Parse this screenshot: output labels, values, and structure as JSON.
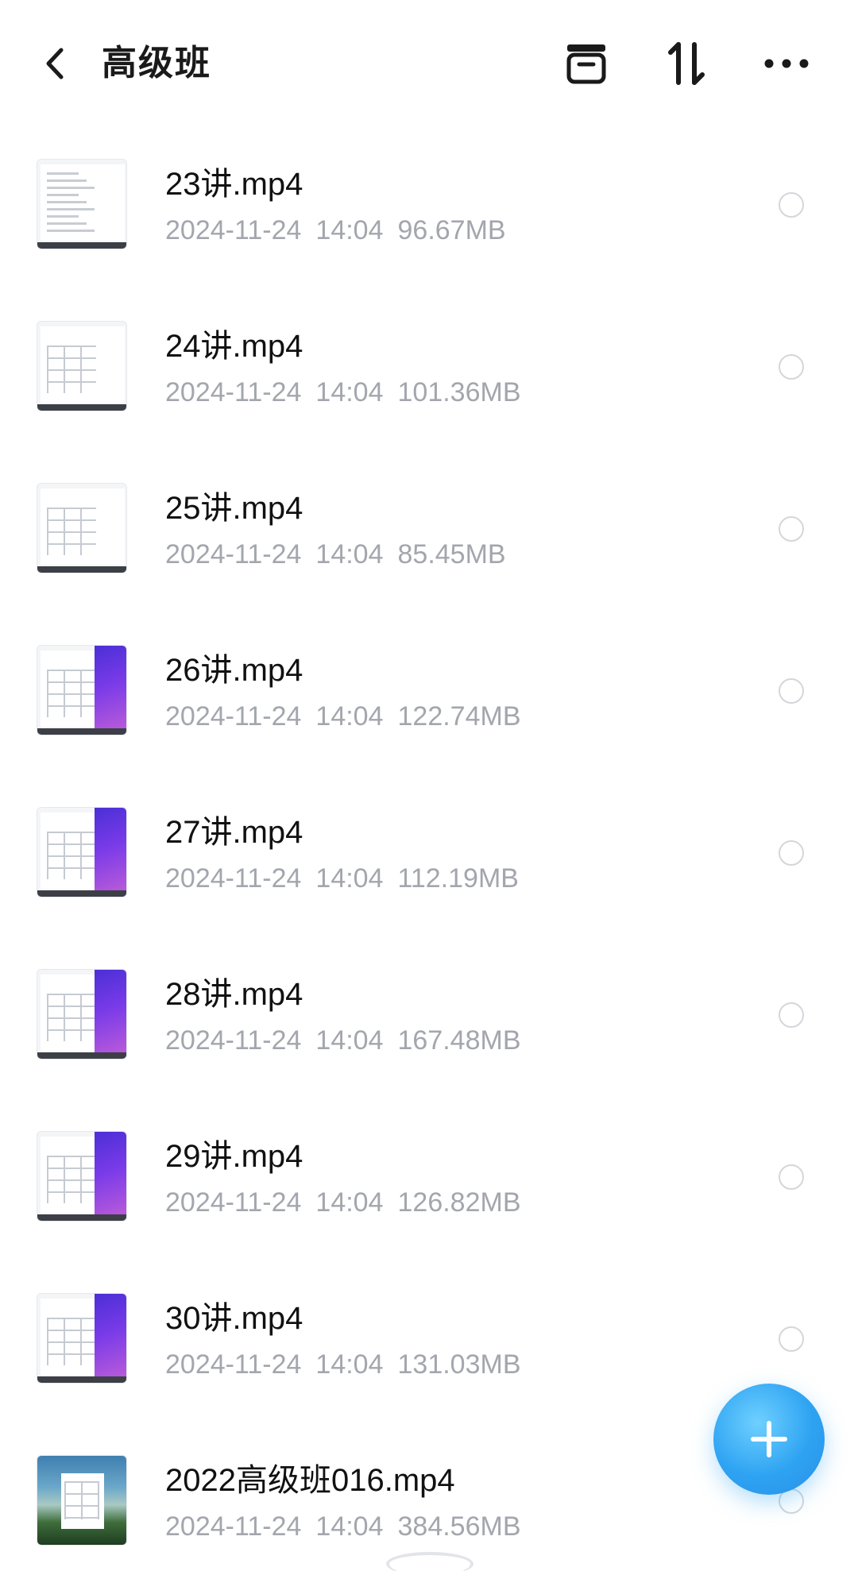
{
  "header": {
    "title": "高级班",
    "back_icon": "chevron-left-icon",
    "actions": [
      "archive-box-icon",
      "sort-arrows-icon",
      "more-horizontal-icon"
    ]
  },
  "files": [
    {
      "name": "23讲.mp4",
      "date": "2024-11-24",
      "time": "14:04",
      "size": "96.67MB",
      "thumb": "doc"
    },
    {
      "name": "24讲.mp4",
      "date": "2024-11-24",
      "time": "14:04",
      "size": "101.36MB",
      "thumb": "doc-grid"
    },
    {
      "name": "25讲.mp4",
      "date": "2024-11-24",
      "time": "14:04",
      "size": "85.45MB",
      "thumb": "doc-grid"
    },
    {
      "name": "26讲.mp4",
      "date": "2024-11-24",
      "time": "14:04",
      "size": "122.74MB",
      "thumb": "purple"
    },
    {
      "name": "27讲.mp4",
      "date": "2024-11-24",
      "time": "14:04",
      "size": "112.19MB",
      "thumb": "purple"
    },
    {
      "name": "28讲.mp4",
      "date": "2024-11-24",
      "time": "14:04",
      "size": "167.48MB",
      "thumb": "purple"
    },
    {
      "name": "29讲.mp4",
      "date": "2024-11-24",
      "time": "14:04",
      "size": "126.82MB",
      "thumb": "purple"
    },
    {
      "name": "30讲.mp4",
      "date": "2024-11-24",
      "time": "14:04",
      "size": "131.03MB",
      "thumb": "purple"
    },
    {
      "name": "2022高级班016.mp4",
      "date": "2024-11-24",
      "time": "14:04",
      "size": "384.56MB",
      "thumb": "landscape"
    }
  ],
  "fab": {
    "icon": "plus-icon"
  },
  "colors": {
    "accent": "#2ea3f2",
    "meta_text": "#a3a6ad"
  }
}
